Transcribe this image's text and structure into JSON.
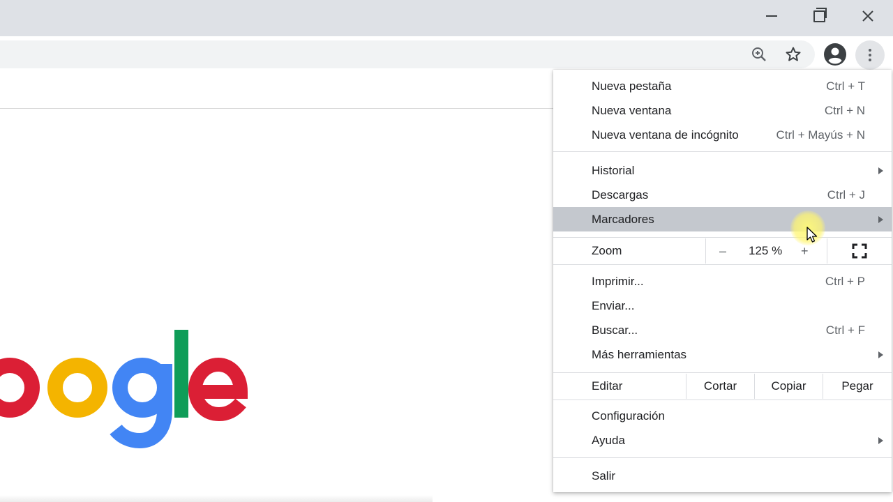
{
  "window": {
    "minimize_icon": "minimize-icon",
    "maximize_icon": "restore-icon",
    "close_icon": "close-icon"
  },
  "toolbar": {
    "icons": [
      "zoom-icon",
      "star-icon",
      "profile-icon",
      "more-menu-icon"
    ]
  },
  "page": {
    "logo_text": "oogle",
    "logo_colors": [
      "#db1f35",
      "#f4b400",
      "#4285f4",
      "#0f9d58",
      "#db1f35"
    ]
  },
  "menu": {
    "new_tab": {
      "label": "Nueva pestaña",
      "shortcut": "Ctrl + T"
    },
    "new_window": {
      "label": "Nueva ventana",
      "shortcut": "Ctrl + N"
    },
    "incognito": {
      "label": "Nueva ventana de incógnito",
      "shortcut": "Ctrl + Mayús + N"
    },
    "history": {
      "label": "Historial"
    },
    "downloads": {
      "label": "Descargas",
      "shortcut": "Ctrl + J"
    },
    "bookmarks": {
      "label": "Marcadores"
    },
    "zoom": {
      "label": "Zoom",
      "minus": "–",
      "value": "125 %",
      "plus": "+"
    },
    "print": {
      "label": "Imprimir...",
      "shortcut": "Ctrl + P"
    },
    "cast": {
      "label": "Enviar..."
    },
    "find": {
      "label": "Buscar...",
      "shortcut": "Ctrl + F"
    },
    "more_tools": {
      "label": "Más herramientas"
    },
    "edit": {
      "label": "Editar",
      "cut": "Cortar",
      "copy": "Copiar",
      "paste": "Pegar"
    },
    "settings": {
      "label": "Configuración"
    },
    "help": {
      "label": "Ayuda"
    },
    "exit": {
      "label": "Salir"
    },
    "highlight_color": "#c4c8ce"
  }
}
